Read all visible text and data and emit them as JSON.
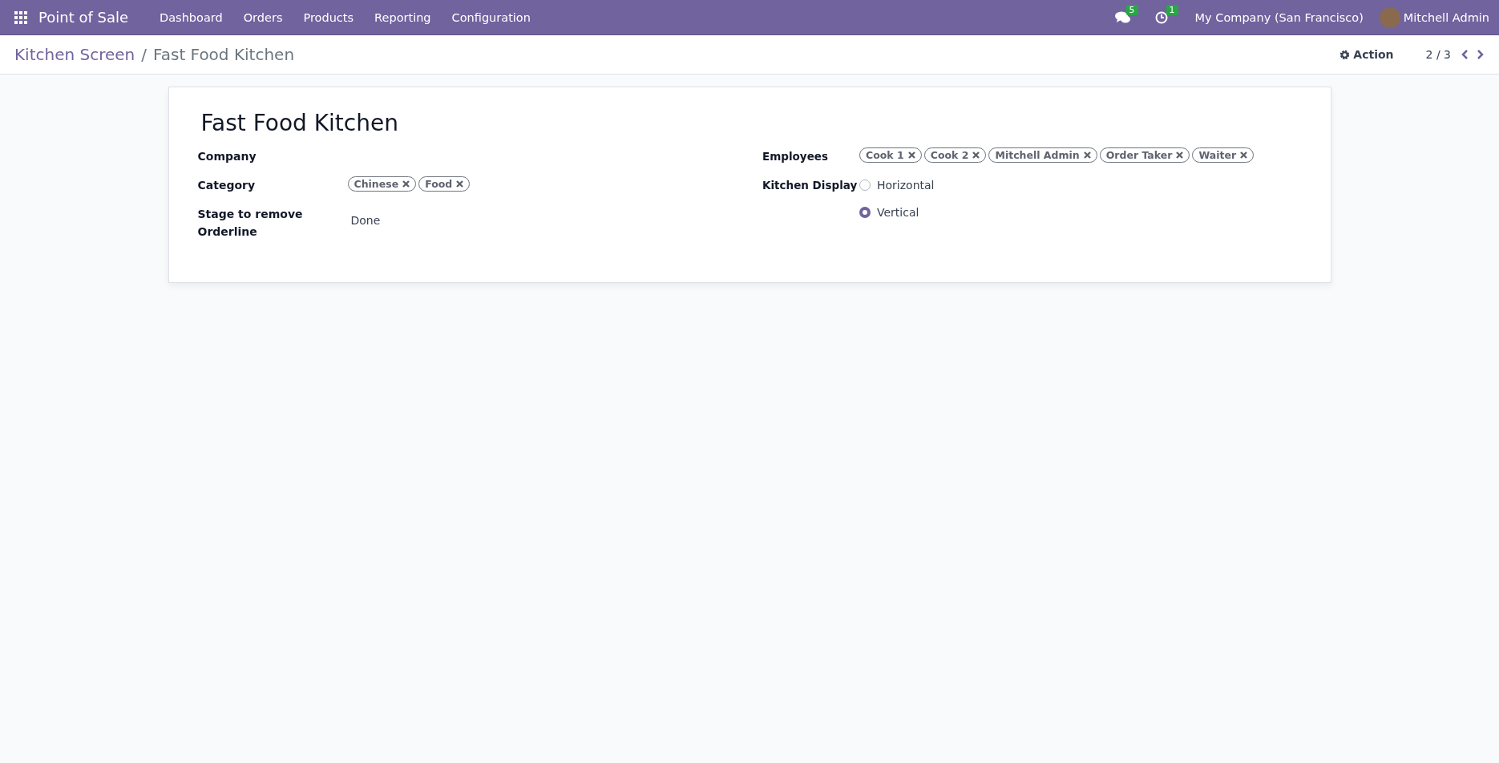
{
  "navbar": {
    "app_name": "Point of Sale",
    "menu": [
      "Dashboard",
      "Orders",
      "Products",
      "Reporting",
      "Configuration"
    ],
    "messages_badge": "5",
    "activities_badge": "1",
    "company": "My Company (San Francisco)",
    "user": "Mitchell Admin"
  },
  "control_panel": {
    "breadcrumb": [
      "Kitchen Screen",
      "Fast Food Kitchen"
    ],
    "breadcrumb_separator": "/",
    "action": "Action",
    "pager": "2 / 3"
  },
  "form": {
    "title": "Fast Food Kitchen",
    "left": [
      {
        "label": "Company",
        "kind": "empty"
      },
      {
        "label": "Category",
        "kind": "tags",
        "tags": [
          "Chinese",
          "Food"
        ]
      },
      {
        "label": "Stage to remove Orderline",
        "kind": "text",
        "value": "Done"
      }
    ],
    "right": [
      {
        "label": "Employees",
        "kind": "tags",
        "tags": [
          "Cook 1",
          "Cook 2",
          "Mitchell Admin",
          "Order Taker",
          "Waiter"
        ]
      },
      {
        "label": "Kitchen Display",
        "kind": "radio",
        "options": [
          {
            "label": "Horizontal",
            "selected": false
          },
          {
            "label": "Vertical",
            "selected": true
          }
        ]
      }
    ]
  }
}
